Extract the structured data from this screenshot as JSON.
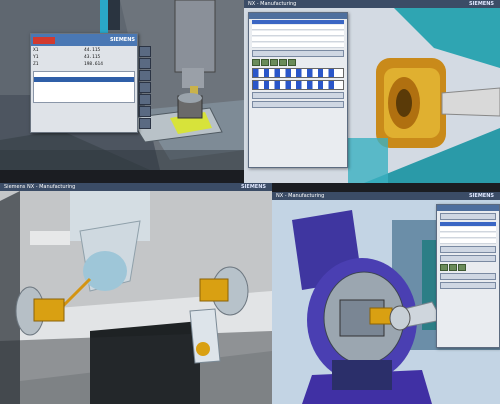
{
  "panels": {
    "top_right": {
      "title": "NX - Manufacturing",
      "brand": "SIEMENS"
    },
    "bottom_left": {
      "title": "Siemens NX - Manufacturing",
      "brand": "SIEMENS"
    },
    "bottom_right": {
      "title": "NX - Manufacturing",
      "brand": "SIEMENS"
    }
  },
  "hmi": {
    "brand": "SIEMENS",
    "axes": [
      {
        "axis": "X1",
        "value": "44.115"
      },
      {
        "axis": "Y1",
        "value": "43.115"
      },
      {
        "axis": "Z1",
        "value": "198.614"
      }
    ]
  },
  "colors": {
    "hmi_header": "#4a78b4",
    "tool_gold": "#d9a012",
    "fixture_purple": "#4a3fb2",
    "alarm_red": "#d23a2f"
  }
}
